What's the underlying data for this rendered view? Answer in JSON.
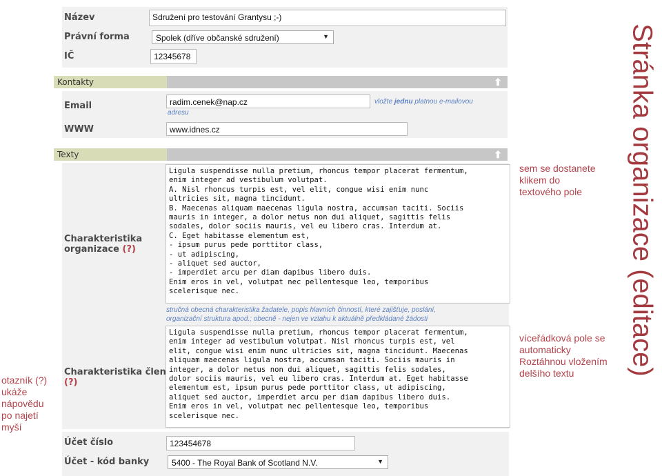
{
  "form": {
    "nazev_label": "Název",
    "nazev_value": "Sdružení pro testování Grantysu ;-)",
    "pravni_forma_label": "Právní forma",
    "pravni_forma_value": "Spolek (dříve občanské sdružení)",
    "ic_label": "IČ",
    "ic_value": "12345678"
  },
  "kontakty": {
    "section_label": "Kontakty",
    "email_label": "Email",
    "email_value": "radim.cenek@nap.cz",
    "email_hint_pre": "vložte ",
    "email_hint_bold": "jednu",
    "email_hint_post": " platnou e-mailovou",
    "email_hint_line2": "adresu",
    "www_label": "WWW",
    "www_value": "www.idnes.cz"
  },
  "texty": {
    "section_label": "Texty",
    "char_org_label_line1": "Charakteristika",
    "char_org_label_line2": "organizace",
    "char_org_qm": "(?)",
    "char_org_text": "Ligula suspendisse nulla pretium, rhoncus tempor placerat fermentum,\nenim integer ad vestibulum volutpat.\nA. Nisl rhoncus turpis est, vel elit, congue wisi enim nunc\nultricies sit, magna tincidunt.\nB. Maecenas aliquam maecenas ligula nostra, accumsan taciti. Sociis\nmauris in integer, a dolor netus non dui aliquet, sagittis felis\nsodales, dolor sociis mauris, vel eu libero cras. Interdum at.\nC. Eget habitasse elementum est,\n- ipsum purus pede porttitor class,\n- ut adipiscing,\n- aliquet sed auctor,\n- imperdiet arcu per diam dapibus libero duis.\nEnim eros in vel, volutpat nec pellentesque leo, temporibus\nscelerisque nec.",
    "char_org_hint_line1": "stručná obecná charakteristika žadatele, popis hlavních činností, které zajišťuje, poslání,",
    "char_org_hint_line2": "organizační struktura apod.; obecně - nejen ve vztahu k aktuálně předkládané žádosti",
    "char_clenu_label": "Charakteristika členů",
    "char_clenu_qm": "(?)",
    "char_clenu_text": "Ligula suspendisse nulla pretium, rhoncus tempor placerat fermentum,\nenim integer ad vestibulum volutpat. Nisl rhoncus turpis est, vel\nelit, congue wisi enim nunc ultricies sit, magna tincidunt. Maecenas\naliquam maecenas ligula nostra, accumsan taciti. Sociis mauris in\ninteger, a dolor netus non dui aliquet, sagittis felis sodales,\ndolor sociis mauris, vel eu libero cras. Interdum at. Eget habitasse\nelementum est, ipsum purus pede porttitor class, ut adipiscing,\naliquet sed auctor, imperdiet arcu per diam dapibus libero duis.\nEnim eros in vel, volutpat nec pellentesque leo, temporibus\nscelerisque nec."
  },
  "ucet": {
    "cislo_label": "Účet číslo",
    "cislo_value": "123454678",
    "kod_banky_label": "Účet - kód banky",
    "kod_banky_value": "5400 - The Royal Bank of Scotland N.V."
  },
  "annotations": {
    "page_title": "Stránka organizace (editace)",
    "note_click": "sem se dostanete\nklikem do\ntextového pole",
    "note_multiline": "víceřádková pole se\nautomaticky\nRoztáhnou vložením\ndelšího textu",
    "note_help": "otazník (?)\nukáže\nnápovědu\npo najetí\nmyší"
  },
  "icons": {
    "collapse": "arrow-up-icon",
    "dropdown": "triangle-down-icon"
  },
  "colors": {
    "annotation": "#b3424a",
    "hint": "#5a7fc2",
    "section_tab": "#d9ddb7",
    "section_bar": "#c7c7c7"
  }
}
